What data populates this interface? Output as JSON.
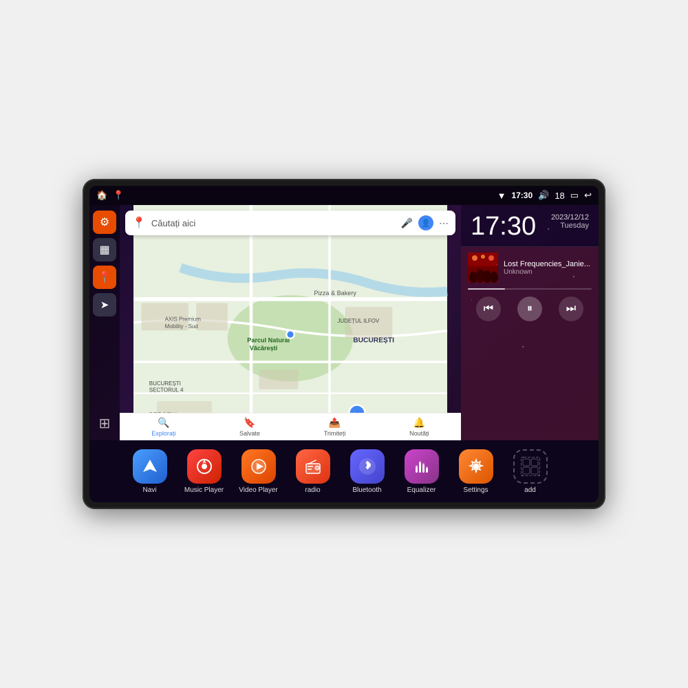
{
  "device": {
    "statusBar": {
      "leftIcons": [
        "🏠",
        "📍"
      ],
      "wifi": "▼",
      "time": "17:30",
      "volume": "🔊",
      "battery": "18",
      "batteryIcon": "🔋",
      "backIcon": "↩"
    },
    "clock": {
      "time": "17:30",
      "year": "2023/12/12",
      "day": "Tuesday"
    },
    "music": {
      "title": "Lost Frequencies_Janie...",
      "artist": "Unknown",
      "albumArt": "🎵"
    },
    "map": {
      "searchPlaceholder": "Căutați aici",
      "places": [
        "AXIS Premium Mobility - Sud",
        "Pizza & Bakery",
        "Parcul Natural Văcărești",
        "BUCUREȘTI",
        "BUCUREȘTI SECTORUL 4",
        "BERCENI",
        "JUDEȚUL ILFOV"
      ],
      "navItems": [
        {
          "icon": "🔍",
          "label": "Explorați"
        },
        {
          "icon": "🔖",
          "label": "Salvate"
        },
        {
          "icon": "📤",
          "label": "Trimiteți"
        },
        {
          "icon": "🔔",
          "label": "Noutăți"
        }
      ]
    },
    "sidebar": {
      "items": [
        {
          "icon": "⚙",
          "type": "orange"
        },
        {
          "icon": "▦",
          "type": "dark"
        },
        {
          "icon": "📍",
          "type": "orange"
        },
        {
          "icon": "➤",
          "type": "dark"
        }
      ],
      "bottomIcon": "⊞"
    },
    "apps": [
      {
        "label": "Navi",
        "icon": "➤",
        "bg": "navi"
      },
      {
        "label": "Music Player",
        "icon": "🎵",
        "bg": "music"
      },
      {
        "label": "Video Player",
        "icon": "▶",
        "bg": "video"
      },
      {
        "label": "radio",
        "icon": "📻",
        "bg": "radio"
      },
      {
        "label": "Bluetooth",
        "icon": "⚡",
        "bg": "bt"
      },
      {
        "label": "Equalizer",
        "icon": "🎚",
        "bg": "eq"
      },
      {
        "label": "Settings",
        "icon": "⚙",
        "bg": "settings"
      },
      {
        "label": "add",
        "icon": "+",
        "bg": "add"
      }
    ]
  }
}
